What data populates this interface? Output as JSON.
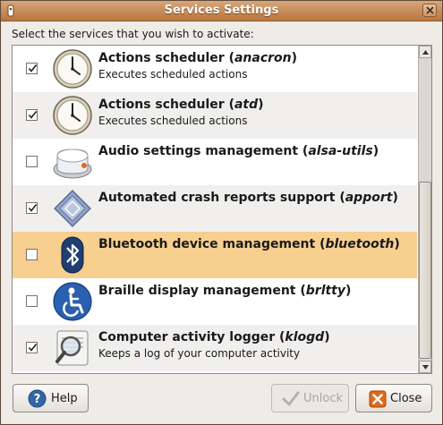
{
  "window": {
    "title": "Services Settings"
  },
  "instruction": "Select the services that you wish to activate:",
  "services": [
    {
      "name": "Actions scheduler (",
      "pkg": "anacron",
      "close": ")",
      "desc": "Executes scheduled actions",
      "checked": true,
      "icon": "clock-icon"
    },
    {
      "name": "Actions scheduler (",
      "pkg": "atd",
      "close": ")",
      "desc": "Executes scheduled actions",
      "checked": true,
      "icon": "clock-icon"
    },
    {
      "name": "Audio settings management (",
      "pkg": "alsa-utils",
      "close": ")",
      "desc": "",
      "checked": false,
      "icon": "volume-knob-icon"
    },
    {
      "name": "Automated crash reports support (",
      "pkg": "apport",
      "close": ")",
      "desc": "",
      "checked": true,
      "icon": "crash-report-icon"
    },
    {
      "name": "Bluetooth device management (",
      "pkg": "bluetooth",
      "close": ")",
      "desc": "",
      "checked": false,
      "icon": "bluetooth-icon",
      "selected": true
    },
    {
      "name": "Braille display management (",
      "pkg": "brltty",
      "close": ")",
      "desc": "",
      "checked": false,
      "icon": "accessibility-icon"
    },
    {
      "name": "Computer activity logger (",
      "pkg": "klogd",
      "close": ")",
      "desc": "Keeps a log of your computer activity",
      "checked": true,
      "icon": "log-magnifier-icon"
    }
  ],
  "buttons": {
    "help": "Help",
    "unlock": "Unlock",
    "close": "Close"
  },
  "colors": {
    "titlebar": "#c88a56",
    "selection": "#f7cf8f",
    "close_icon": "#e0691c"
  }
}
